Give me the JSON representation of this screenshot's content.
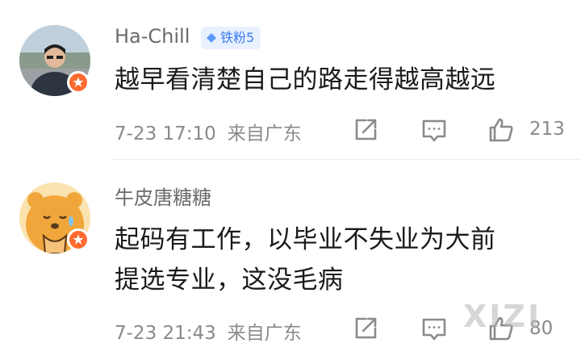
{
  "comments": [
    {
      "username": "Ha-Chill",
      "fan_badge": "铁粉5",
      "text": [
        "越早看清楚自己的路走得越高越远"
      ],
      "date": "7-23 17:10",
      "location": "来自广东",
      "likes": "213"
    },
    {
      "username": "牛皮唐糖糖",
      "text": [
        "起码有工作，以毕业不失业为大前",
        "提选专业，这没毛病"
      ],
      "date": "7-23 21:43",
      "location": "来自广东",
      "likes": "80"
    }
  ],
  "watermark": "XIZI",
  "icons": {
    "share": "share-icon",
    "reply": "comment-icon",
    "like": "thumbs-up-icon",
    "verified": "verified-badge-icon",
    "fan": "diamond-icon"
  },
  "colors": {
    "accent_blue": "#3a7bf0",
    "badge_orange": "#ff6a2f",
    "text_gray": "#8a8a8a"
  }
}
